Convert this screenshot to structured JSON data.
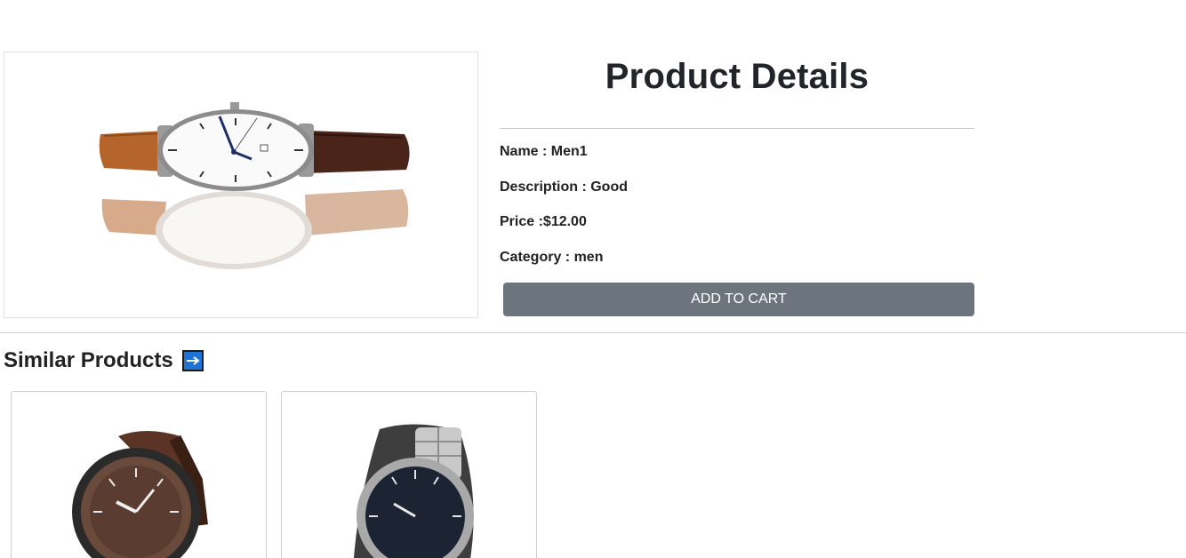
{
  "product": {
    "heading": "Product Details",
    "name_label": "Name : Men1",
    "description_label": "Description : Good",
    "price_label": "Price :$12.00",
    "category_label": "Category : men",
    "add_to_cart_label": "ADD TO CART"
  },
  "similar": {
    "heading": "Similar Products"
  },
  "colors": {
    "button_bg": "#6c757d",
    "arrow_bg": "#1e74d6"
  }
}
